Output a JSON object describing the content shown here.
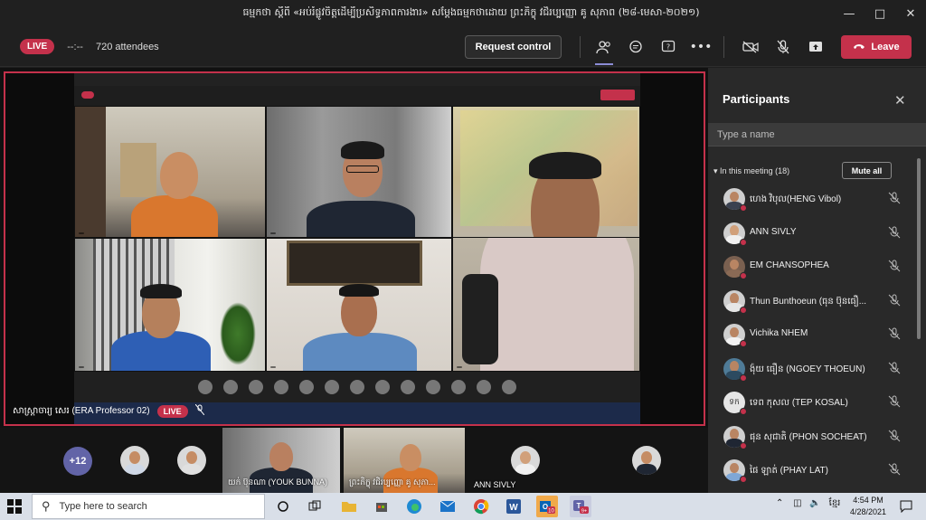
{
  "window": {
    "title": "ធម្មកថា ស្ដីពី «អប់រំផ្លូវចិត្តដើម្បីប្រសិទ្ធភាពការងារ» សម្ដែងធម្មកថាដោយ ព្រះភិក្ខុ វជិរប្បញ្ញោ គូ សុភាព (២៨-មេសា-២០២១)"
  },
  "toolbar": {
    "live_label": "LIVE",
    "timer": "--:--",
    "attendees": "720 attendees",
    "request_control": "Request control",
    "leave_label": "Leave"
  },
  "stage": {
    "presenter_name": "សាស្ត្រាចារ្យ សេរ (ERA Professor 02)",
    "presenter_live": "LIVE"
  },
  "gallery": {
    "overflow_count": "+12",
    "tiles": [
      {
        "name": "យក់ ប៊ុនណា (YOUK BUNNA)"
      },
      {
        "name": "ព្រះភិក្ខុ វជិរប្បញ្ញោ គូ សុភា..."
      },
      {
        "name": "ANN SIVLY"
      }
    ]
  },
  "panel": {
    "title": "Participants",
    "search_placeholder": "Type a name",
    "in_meeting": "In this meeting (18)",
    "mute_all": "Mute all",
    "participants": [
      {
        "name": "ហេង វិបុល(HENG Vibol)"
      },
      {
        "name": "ANN SIVLY"
      },
      {
        "name": "EM CHANSOPHEA"
      },
      {
        "name": "Thun Bunthoeun (ធុន ប៊ុនធឿ..."
      },
      {
        "name": "Vichika NHEM"
      },
      {
        "name": "ង៉ុយ ធឿន (NGOEY THOEUN)"
      },
      {
        "name": "ទេព កុសល (TEP KOSAL)",
        "initials": "ទក"
      },
      {
        "name": "ផុន សុជាតិ (PHON SOCHEAT)"
      },
      {
        "name": "ផៃ ឡាត់ (PHAY LAT)"
      }
    ]
  },
  "taskbar": {
    "search_placeholder": "Type here to search",
    "time": "4:54 PM",
    "date": "4/28/2021",
    "lang": "ខ្មែរ",
    "outlook_badge": "10",
    "teams_badge": "9+"
  },
  "colors": {
    "accent_red": "#c4314b",
    "teams_purple": "#6264a7"
  }
}
